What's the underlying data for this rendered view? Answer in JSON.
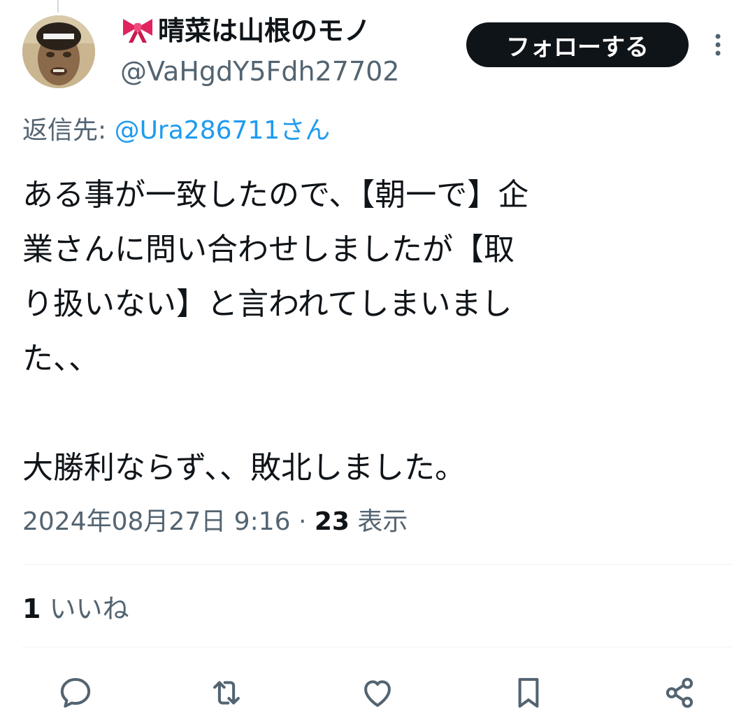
{
  "tweet": {
    "author": {
      "display_name": "晴菜は山根のモノ",
      "display_name_emoji": "ribbon-icon",
      "handle": "@VaHgdY5Fdh27702"
    },
    "follow_label": "フォローする",
    "reply_to": {
      "prefix": "返信先: ",
      "mention": "@Ura286711さん"
    },
    "body_lines": [
      "ある事が一致したので、【朝一で】企",
      "業さんに問い合わせしましたが【取",
      "り扱いない】と言われてしまいまし",
      "た、、",
      "",
      "大勝利ならず、、敗北しました。"
    ],
    "timestamp": "2024年08月27日 9:16",
    "meta_separator": " · ",
    "views_count": "23",
    "views_label": " 表示",
    "likes_count": "1",
    "likes_label": " いいね"
  },
  "actions": [
    {
      "name": "reply-icon"
    },
    {
      "name": "retweet-icon"
    },
    {
      "name": "like-icon"
    },
    {
      "name": "bookmark-icon"
    },
    {
      "name": "share-icon"
    }
  ],
  "colors": {
    "text_primary": "#0f1419",
    "text_secondary": "#536471",
    "link": "#1d9bf0",
    "follow_bg": "#0f1419",
    "divider": "#eff3f4",
    "ribbon": "#e0245e"
  }
}
